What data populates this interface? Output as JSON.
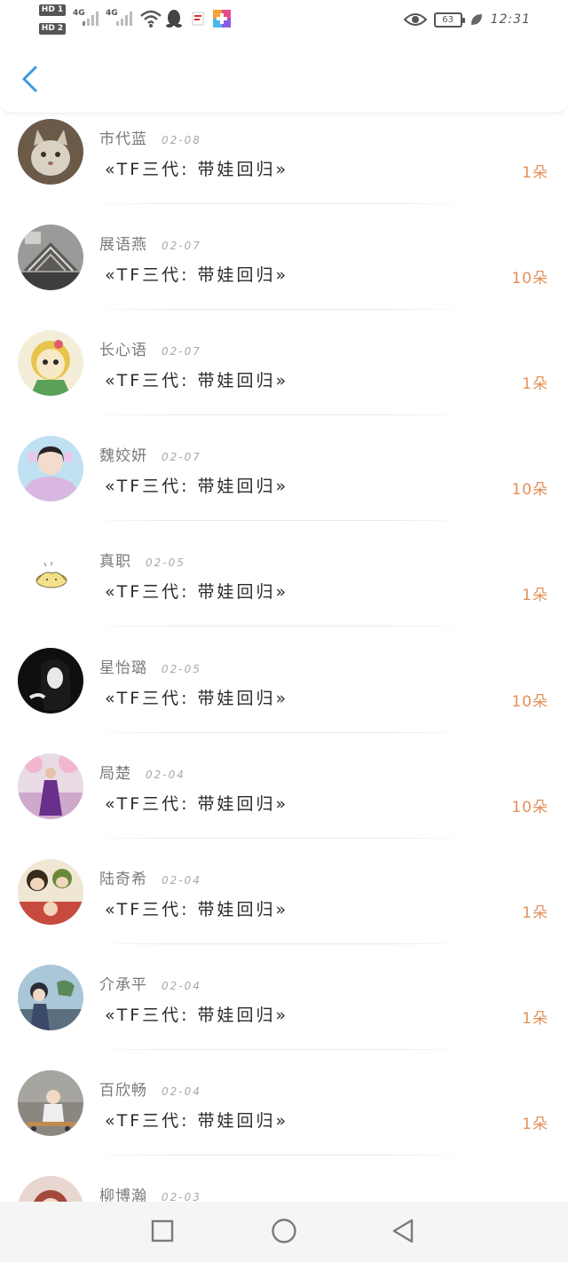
{
  "status_bar": {
    "hd1": "HD 1",
    "hd2": "HD 2",
    "net1": "4G",
    "net2": "4G",
    "battery": "63",
    "time": "12:31"
  },
  "colors": {
    "accent_blue": "#3a9be0",
    "count_orange": "#e3915a",
    "background": "#ffffff"
  },
  "header": {
    "back_icon": "chevron-left-icon"
  },
  "records": [
    {
      "name": "市代蓝",
      "date": "02-08",
      "title": "«TF三代: 带娃回归»",
      "count": "1朵"
    },
    {
      "name": "展语燕",
      "date": "02-07",
      "title": "«TF三代: 带娃回归»",
      "count": "10朵"
    },
    {
      "name": "长心语",
      "date": "02-07",
      "title": "«TF三代: 带娃回归»",
      "count": "1朵"
    },
    {
      "name": "魏姣妍",
      "date": "02-07",
      "title": "«TF三代: 带娃回归»",
      "count": "10朵"
    },
    {
      "name": "真职",
      "date": "02-05",
      "title": "«TF三代: 带娃回归»",
      "count": "1朵"
    },
    {
      "name": "星怡璐",
      "date": "02-05",
      "title": "«TF三代: 带娃回归»",
      "count": "10朵"
    },
    {
      "name": "局楚",
      "date": "02-04",
      "title": "«TF三代: 带娃回归»",
      "count": "10朵"
    },
    {
      "name": "陆奇希",
      "date": "02-04",
      "title": "«TF三代: 带娃回归»",
      "count": "1朵"
    },
    {
      "name": "介承平",
      "date": "02-04",
      "title": "«TF三代: 带娃回归»",
      "count": "1朵"
    },
    {
      "name": "百欣畅",
      "date": "02-04",
      "title": "«TF三代: 带娃回归»",
      "count": "1朵"
    },
    {
      "name": "柳博瀚",
      "date": "02-03",
      "title": "",
      "count": ""
    }
  ],
  "nav": {
    "recents_icon": "square-icon",
    "home_icon": "circle-icon",
    "back_icon": "triangle-back-icon"
  }
}
